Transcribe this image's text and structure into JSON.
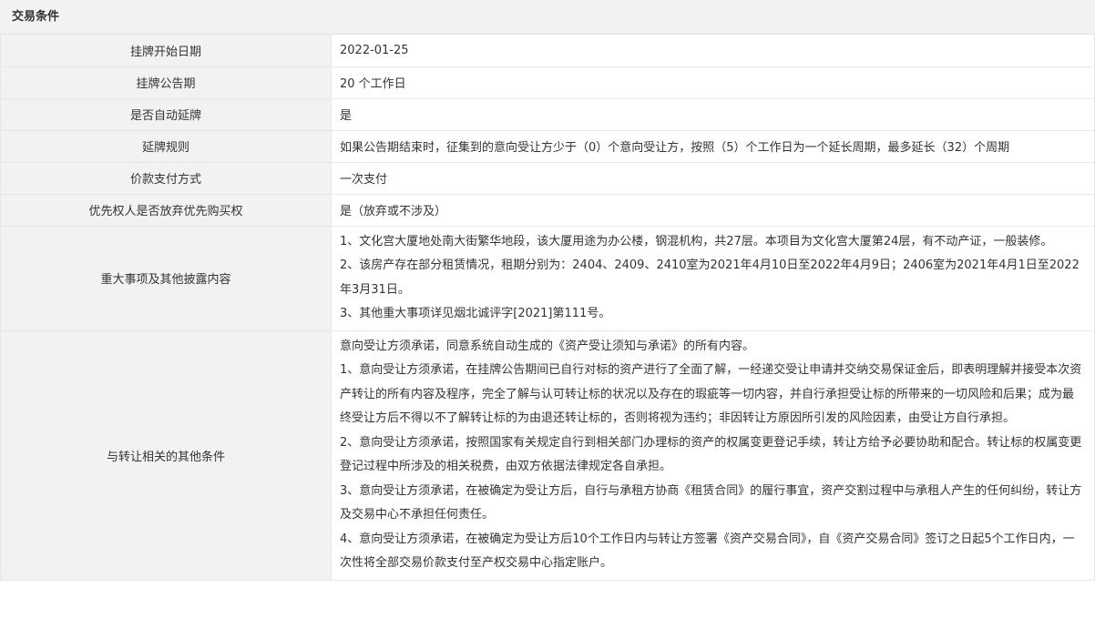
{
  "section": {
    "title": "交易条件"
  },
  "rows": [
    {
      "label": "挂牌开始日期",
      "value": "2022-01-25"
    },
    {
      "label": "挂牌公告期",
      "value": "20 个工作日"
    },
    {
      "label": "是否自动延牌",
      "value": "是"
    },
    {
      "label": "延牌规则",
      "value": "如果公告期结束时，征集到的意向受让方少于（0）个意向受让方，按照（5）个工作日为一个延长周期，最多延长（32）个周期"
    },
    {
      "label": "价款支付方式",
      "value": "一次支付"
    },
    {
      "label": "优先权人是否放弃优先购买权",
      "value": "是（放弃或不涉及）"
    }
  ],
  "major_matters": {
    "label": "重大事项及其他披露内容",
    "paragraphs": [
      "1、文化宫大厦地处南大街繁华地段，该大厦用途为办公楼，钢混机构，共27层。本项目为文化宫大厦第24层，有不动产证，一般装修。",
      "2、该房产存在部分租赁情况，租期分别为：2404、2409、2410室为2021年4月10日至2022年4月9日；2406室为2021年4月1日至2022年3月31日。",
      "3、其他重大事项详见烟北诚评字[2021]第111号。"
    ]
  },
  "other_conditions": {
    "label": "与转让相关的其他条件",
    "paragraphs": [
      "意向受让方须承诺，同意系统自动生成的《资产受让须知与承诺》的所有内容。",
      "1、意向受让方须承诺，在挂牌公告期间已自行对标的资产进行了全面了解，一经递交受让申请并交纳交易保证金后，即表明理解并接受本次资产转让的所有内容及程序，完全了解与认可转让标的状况以及存在的瑕疵等一切内容，并自行承担受让标的所带来的一切风险和后果；成为最终受让方后不得以不了解转让标的为由退还转让标的，否则将视为违约；非因转让方原因所引发的风险因素，由受让方自行承担。",
      "2、意向受让方须承诺，按照国家有关规定自行到相关部门办理标的资产的权属变更登记手续，转让方给予必要协助和配合。转让标的权属变更登记过程中所涉及的相关税费，由双方依据法律规定各自承担。",
      "3、意向受让方须承诺，在被确定为受让方后，自行与承租方协商《租赁合同》的履行事宜，资产交割过程中与承租人产生的任何纠纷，转让方及交易中心不承担任何责任。",
      "4、意向受让方须承诺，在被确定为受让方后10个工作日内与转让方签署《资产交易合同》，自《资产交易合同》签订之日起5个工作日内，一次性将全部交易价款支付至产权交易中心指定账户。"
    ]
  }
}
